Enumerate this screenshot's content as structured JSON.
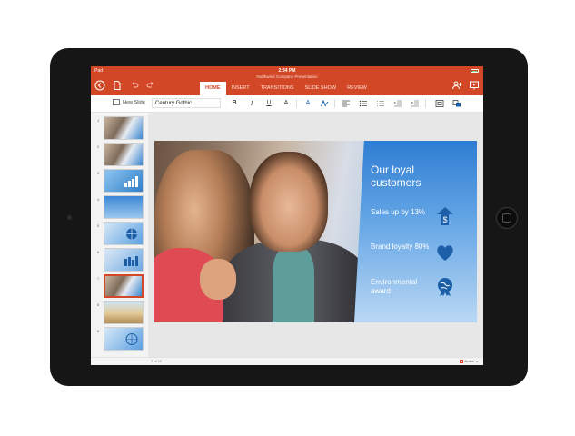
{
  "status": {
    "carrier": "iPad",
    "time": "2:34 PM"
  },
  "document": {
    "title": "Northwind Company Presentation"
  },
  "tabs": [
    {
      "label": "HOME",
      "active": true
    },
    {
      "label": "INSERT",
      "active": false
    },
    {
      "label": "TRANSITIONS",
      "active": false
    },
    {
      "label": "SLIDE SHOW",
      "active": false
    },
    {
      "label": "REVIEW",
      "active": false
    }
  ],
  "ribbon": {
    "new_slide_label": "New Slide",
    "font_name": "Century Gothic",
    "bold": "B",
    "italic": "I",
    "underline": "U",
    "font_size_glyph": "A"
  },
  "thumbnails": [
    {
      "number": "1",
      "style": "photo"
    },
    {
      "number": "2",
      "style": "photo"
    },
    {
      "number": "3",
      "style": "chart"
    },
    {
      "number": "4",
      "style": "blue"
    },
    {
      "number": "5",
      "style": "globe"
    },
    {
      "number": "6",
      "style": "chart"
    },
    {
      "number": "7",
      "style": "selected"
    },
    {
      "number": "8",
      "style": "sand"
    },
    {
      "number": "9",
      "style": "globe"
    }
  ],
  "slide": {
    "title": "Our loyal customers",
    "items": [
      {
        "text": "Sales up by 13%",
        "icon": "dollar-arrow-up-icon"
      },
      {
        "text": "Brand loyalty 80%",
        "icon": "heart-icon"
      },
      {
        "text": "Environmental award",
        "icon": "globe-award-icon"
      }
    ]
  },
  "status_bar": {
    "slide_count": "7 of 11",
    "notes_label": "Notes"
  },
  "colors": {
    "accent": "#d24726",
    "slide_blue": "#1c5fa8"
  }
}
